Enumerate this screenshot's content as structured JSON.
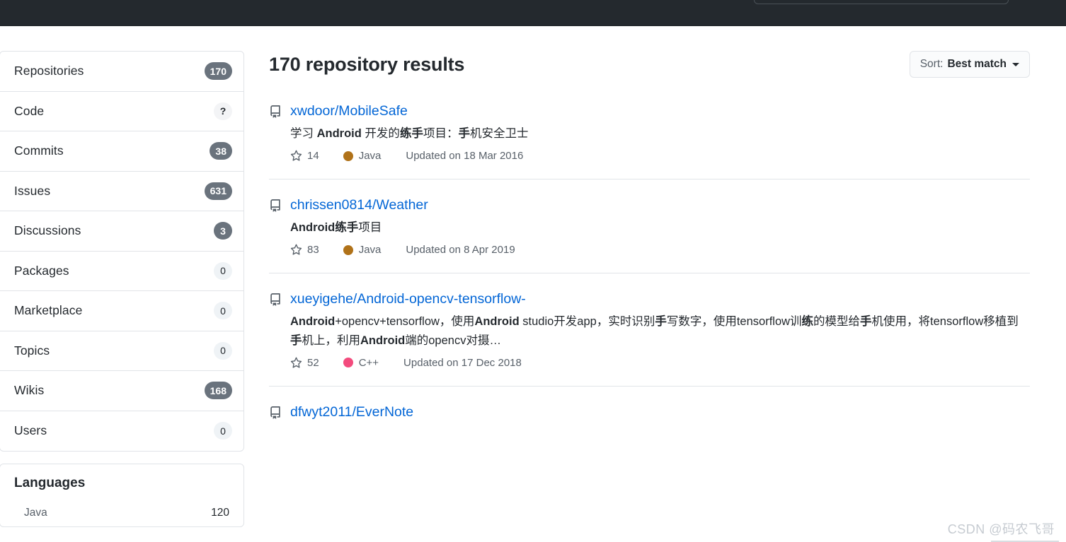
{
  "header": {
    "search_placeholder": ""
  },
  "sidebar": {
    "filters": [
      {
        "label": "Repositories",
        "count": "170",
        "style": "dark"
      },
      {
        "label": "Code",
        "count": "?",
        "style": "q"
      },
      {
        "label": "Commits",
        "count": "38",
        "style": "dark"
      },
      {
        "label": "Issues",
        "count": "631",
        "style": "dark"
      },
      {
        "label": "Discussions",
        "count": "3",
        "style": "dark"
      },
      {
        "label": "Packages",
        "count": "0",
        "style": "light"
      },
      {
        "label": "Marketplace",
        "count": "0",
        "style": "light"
      },
      {
        "label": "Topics",
        "count": "0",
        "style": "light"
      },
      {
        "label": "Wikis",
        "count": "168",
        "style": "dark"
      },
      {
        "label": "Users",
        "count": "0",
        "style": "light"
      }
    ],
    "languages": {
      "title": "Languages",
      "items": [
        {
          "name": "Java",
          "count": "120"
        }
      ]
    }
  },
  "main": {
    "results_title": "170 repository results",
    "sort": {
      "prefix": "Sort:",
      "value": "Best match"
    },
    "repos": [
      {
        "name": "xwdoor/MobileSafe",
        "description_html": "学习 <b>Android</b> 开发的<b>练手</b>项目：<b>手</b>机安全卫士",
        "stars": "14",
        "language": "Java",
        "language_color": "#b07219",
        "updated": "Updated on 18 Mar 2016"
      },
      {
        "name": "chrissen0814/Weather",
        "description_html": "<b>Android练手</b>项目",
        "stars": "83",
        "language": "Java",
        "language_color": "#b07219",
        "updated": "Updated on 8 Apr 2019"
      },
      {
        "name": "xueyigehe/Android-opencv-tensorflow-",
        "description_html": "<b>Android</b>+opencv+tensorflow，使用<b>Android</b> studio开发app，实时识别<b>手</b>写数字，使用tensorflow训<b>练</b>的模型给<b>手</b>机使用，将tensorflow移植到<b>手</b>机上，利用<b>Android</b>端的opencv对摄…",
        "stars": "52",
        "language": "C++",
        "language_color": "#f34b7d",
        "updated": "Updated on 17 Dec 2018"
      },
      {
        "name": "dfwyt2011/EverNote",
        "description_html": "",
        "stars": "",
        "language": "",
        "language_color": "",
        "updated": ""
      }
    ]
  },
  "watermark": "CSDN @码农飞哥"
}
